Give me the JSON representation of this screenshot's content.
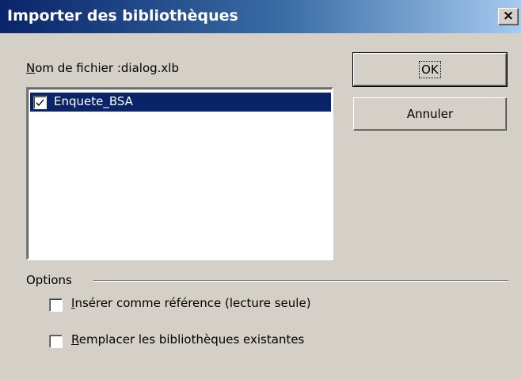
{
  "window": {
    "title": "Importer des bibliothèques",
    "close_glyph": "×",
    "close_icon": "close-icon"
  },
  "file": {
    "label_prefix": "Nom de fichier :",
    "label_accesskey": "N",
    "label_rest": "om de fichier :",
    "filename": "dialog.xlb"
  },
  "libraries": [
    {
      "label": "Enquete_BSA",
      "checked": true,
      "selected": true
    }
  ],
  "buttons": {
    "ok": "OK",
    "cancel": "Annuler"
  },
  "options": {
    "label": "Options",
    "items": [
      {
        "accesskey": "I",
        "rest": "nsérer comme référence (lecture seule)",
        "checked": false
      },
      {
        "accesskey": "R",
        "rest": "emplacer les bibliothèques existantes",
        "checked": false
      }
    ]
  },
  "colors": {
    "dialog_bg": "#d4d0c8",
    "titlebar_start": "#0a246a",
    "titlebar_end": "#a6caf0",
    "selection": "#0a246a"
  }
}
